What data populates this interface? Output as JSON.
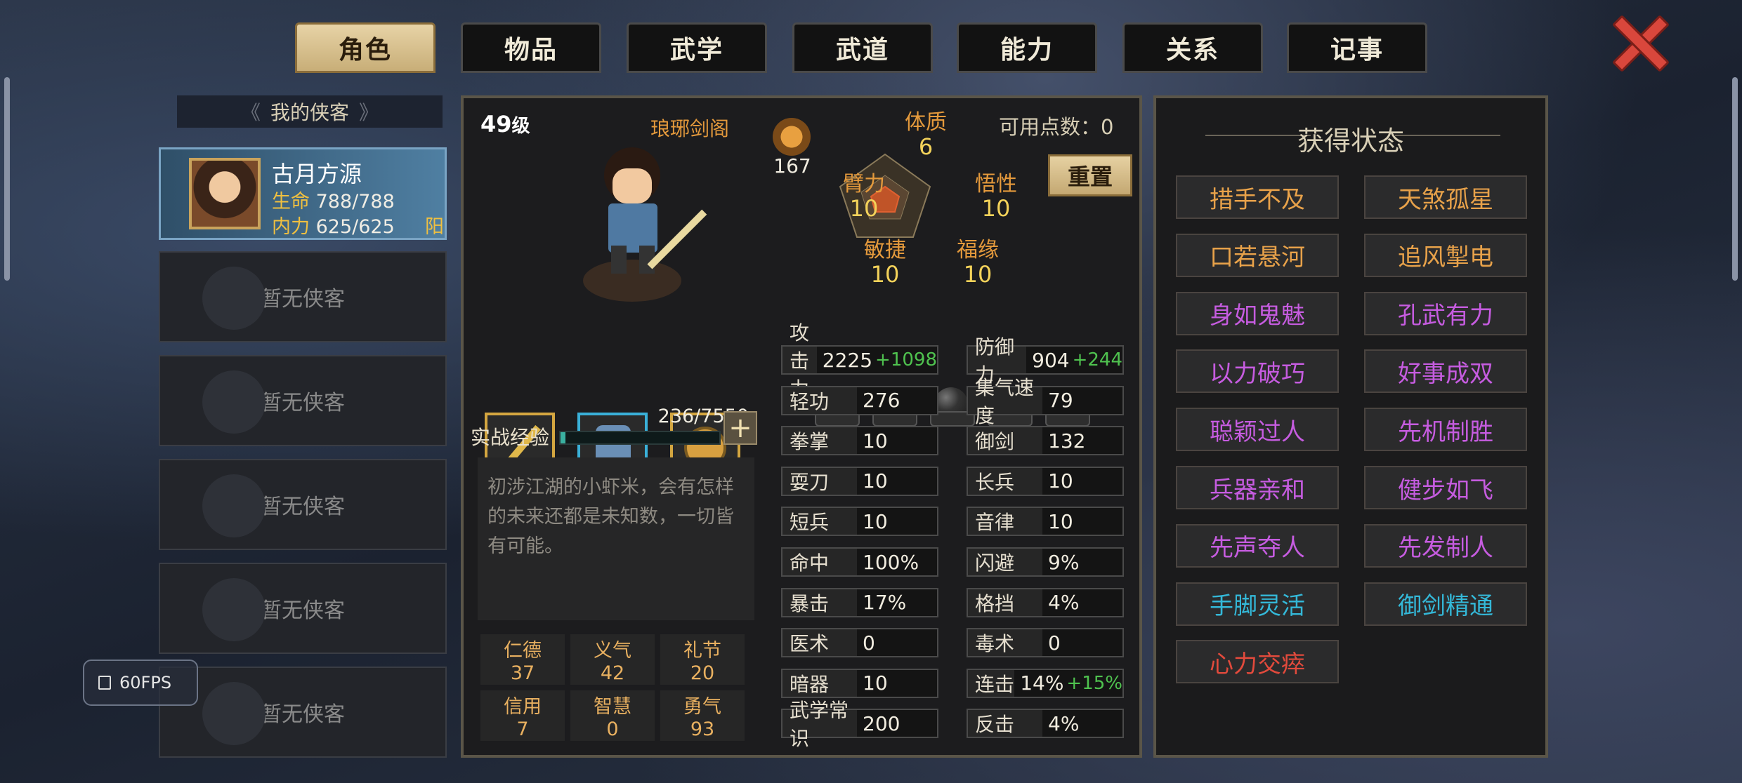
{
  "tabs": [
    "角色",
    "物品",
    "武学",
    "武道",
    "能力",
    "关系",
    "记事"
  ],
  "active_tab": "角色",
  "left": {
    "header": "我的侠客",
    "hero": {
      "name": "古月方源",
      "hp_label": "生命",
      "hp": "788/788",
      "mp_label": "内力",
      "mp": "625/625",
      "tag": "阳"
    },
    "empty_label": "暂无侠客"
  },
  "fps": "60FPS",
  "character": {
    "level_num": "49",
    "level_unit": "级",
    "sect": "琅琊剑阁",
    "power_value": "167",
    "available_points_label": "可用点数：",
    "available_points": "0",
    "reset_label": "重置",
    "attributes": {
      "tizhi": {
        "label": "体质",
        "value": "6"
      },
      "bili": {
        "label": "臂力",
        "value": "10"
      },
      "wuxing": {
        "label": "悟性",
        "value": "10"
      },
      "minjie": {
        "label": "敏捷",
        "value": "10"
      },
      "fuyuan": {
        "label": "福缘",
        "value": "10"
      }
    },
    "exp_label": "实战经验",
    "exp_value": "236/7550",
    "exp_fraction": 0.031,
    "description": "初涉江湖的小虾米，会有怎样的未来还都是未知数，一切皆有可能。",
    "virtues": [
      {
        "label": "仁德",
        "value": "37"
      },
      {
        "label": "义气",
        "value": "42"
      },
      {
        "label": "礼节",
        "value": "20"
      },
      {
        "label": "信用",
        "value": "7"
      },
      {
        "label": "智慧",
        "value": "0"
      },
      {
        "label": "勇气",
        "value": "93"
      }
    ]
  },
  "stats_left": [
    {
      "label": "攻击力",
      "value": "2225",
      "bonus": "+1098"
    },
    {
      "label": "轻功",
      "value": "276",
      "bonus": ""
    },
    {
      "label": "拳掌",
      "value": "10",
      "bonus": ""
    },
    {
      "label": "耍刀",
      "value": "10",
      "bonus": ""
    },
    {
      "label": "短兵",
      "value": "10",
      "bonus": ""
    },
    {
      "label": "命中",
      "value": "100%",
      "bonus": ""
    },
    {
      "label": "暴击",
      "value": "17%",
      "bonus": ""
    },
    {
      "label": "医术",
      "value": "0",
      "bonus": ""
    },
    {
      "label": "暗器",
      "value": "10",
      "bonus": ""
    },
    {
      "label": "武学常识",
      "value": "200",
      "bonus": ""
    }
  ],
  "stats_right": [
    {
      "label": "防御力",
      "value": "904",
      "bonus": "+244"
    },
    {
      "label": "集气速度",
      "value": "79",
      "bonus": ""
    },
    {
      "label": "御剑",
      "value": "132",
      "bonus": ""
    },
    {
      "label": "长兵",
      "value": "10",
      "bonus": ""
    },
    {
      "label": "音律",
      "value": "10",
      "bonus": ""
    },
    {
      "label": "闪避",
      "value": "9%",
      "bonus": ""
    },
    {
      "label": "格挡",
      "value": "4%",
      "bonus": ""
    },
    {
      "label": "毒术",
      "value": "0",
      "bonus": ""
    },
    {
      "label": "连击",
      "value": "14%",
      "bonus": "+15%"
    },
    {
      "label": "反击",
      "value": "4%",
      "bonus": ""
    }
  ],
  "status_panel": {
    "title": "获得状态",
    "items": [
      {
        "label": "措手不及",
        "color": "#e8a24a"
      },
      {
        "label": "天煞孤星",
        "color": "#e8a24a"
      },
      {
        "label": "口若悬河",
        "color": "#e8a24a"
      },
      {
        "label": "追风掣电",
        "color": "#e8a24a"
      },
      {
        "label": "身如鬼魅",
        "color": "#c65ce0"
      },
      {
        "label": "孔武有力",
        "color": "#c65ce0"
      },
      {
        "label": "以力破巧",
        "color": "#c65ce0"
      },
      {
        "label": "好事成双",
        "color": "#c65ce0"
      },
      {
        "label": "聪颖过人",
        "color": "#c65ce0"
      },
      {
        "label": "先机制胜",
        "color": "#c65ce0"
      },
      {
        "label": "兵器亲和",
        "color": "#c65ce0"
      },
      {
        "label": "健步如飞",
        "color": "#c65ce0"
      },
      {
        "label": "先声夺人",
        "color": "#c65ce0"
      },
      {
        "label": "先发制人",
        "color": "#c65ce0"
      },
      {
        "label": "手脚灵活",
        "color": "#34b8d8"
      },
      {
        "label": "御剑精通",
        "color": "#34b8d8"
      },
      {
        "label": "心力交瘁",
        "color": "#e24a3c"
      }
    ]
  }
}
